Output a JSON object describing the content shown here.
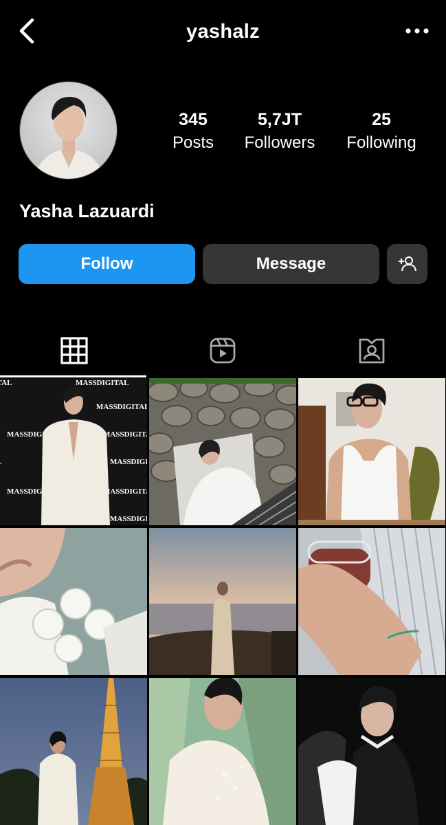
{
  "header": {
    "username": "yashalz",
    "back_icon": "chevron-left-icon",
    "more_icon": "more-horizontal-icon"
  },
  "profile": {
    "full_name": "Yasha Lazuardi",
    "avatar_icon": "profile-avatar",
    "stats": {
      "posts_count": "345",
      "posts_label": "Posts",
      "followers_count": "5,7JT",
      "followers_label": "Followers",
      "following_count": "25",
      "following_label": "Following"
    }
  },
  "actions": {
    "follow_label": "Follow",
    "message_label": "Message",
    "add_user_icon": "add-person-icon"
  },
  "tabs": {
    "active": "grid",
    "items": [
      "grid-icon",
      "reels-icon",
      "tagged-icon"
    ]
  },
  "colors": {
    "background": "#000000",
    "follow_button": "#1d96f2",
    "secondary_button": "#363636",
    "text": "#ffffff"
  },
  "posts": {
    "post1_watermark": "MASSDIGITAL"
  }
}
